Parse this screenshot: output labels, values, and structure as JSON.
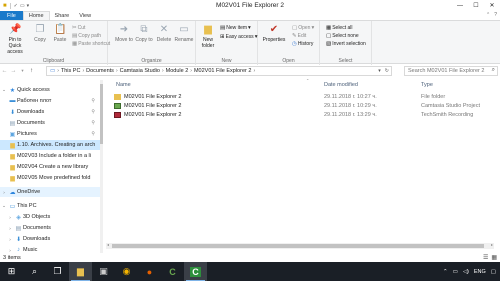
{
  "window": {
    "title": "M02V01 File Explorer 2",
    "controls": {
      "minimize": "—",
      "maximize": "☐",
      "close": "✕"
    }
  },
  "tabs": [
    "File",
    "Home",
    "Share",
    "View"
  ],
  "ribbon": {
    "clipboard": {
      "label": "Clipboard",
      "pin": "Pin to Quick access",
      "copy": "Copy",
      "paste": "Paste",
      "cut": "Cut",
      "copy_path": "Copy path",
      "paste_shortcut": "Paste shortcut"
    },
    "organize": {
      "label": "Organize",
      "move_to": "Move to",
      "copy_to": "Copy to",
      "delete": "Delete",
      "rename": "Rename"
    },
    "new": {
      "label": "New",
      "new_folder": "New folder",
      "new_item": "New item",
      "easy_access": "Easy access"
    },
    "open": {
      "label": "Open",
      "properties": "Properties",
      "open": "Open",
      "edit": "Edit",
      "history": "History"
    },
    "select": {
      "label": "Select",
      "select_all": "Select all",
      "select_none": "Select none",
      "invert": "Invert selection"
    }
  },
  "address": {
    "crumbs": [
      "This PC",
      "Documents",
      "Camtasia Studio",
      "Module 2",
      "M02V01 File Explorer 2"
    ],
    "search_placeholder": "Search M02V01 File Explorer 2"
  },
  "nav": {
    "quick_access": "Quick access",
    "quick_items": [
      "Работен плот",
      "Downloads",
      "Documents",
      "Pictures",
      "1.10. Archives. Creating an arch",
      "M02V03 Include a folder in a li",
      "M02V04 Create a new library",
      "M02V05 Move predefined fold"
    ],
    "onedrive": "OneDrive",
    "this_pc": "This PC",
    "pc_items": [
      "3D Objects",
      "Documents",
      "Downloads",
      "Music"
    ]
  },
  "columns": {
    "name": "Name",
    "date": "Date modified",
    "type": "Type"
  },
  "files": [
    {
      "name": "M02V01 File Explorer 2",
      "date": "29.11.2018 г. 10:27 ч.",
      "type": "File folder",
      "icon": "folder-icon",
      "color": "#e8c050"
    },
    {
      "name": "M02V01 File Explorer 2",
      "date": "29.11.2018 г. 10:29 ч.",
      "type": "Camtasia Studio Project",
      "icon": "camtasia-project-icon",
      "color": "#6aa84f"
    },
    {
      "name": "M02V01 File Explorer 2",
      "date": "29.11.2018 г. 13:29 ч.",
      "type": "TechSmith Recording",
      "icon": "techsmith-recording-icon",
      "color": "#b02a3a"
    }
  ],
  "status": {
    "count": "3 items"
  },
  "taskbar": {
    "lang": "ENG"
  },
  "colors": {
    "accent": "#1979ca",
    "selection": "#cce8ff",
    "taskbar": "#1a1f26"
  }
}
